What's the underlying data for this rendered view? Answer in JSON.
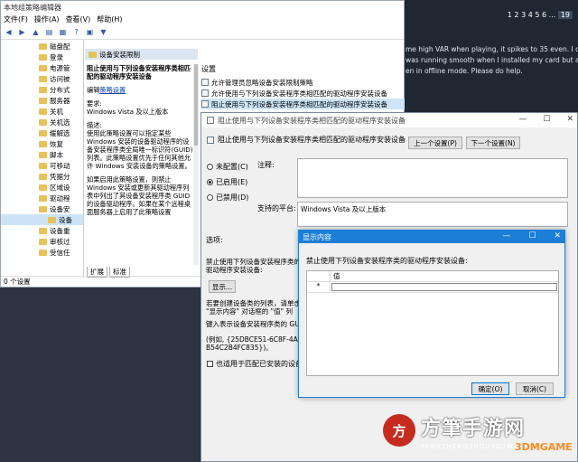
{
  "forum": {
    "pages": [
      "1",
      "2",
      "3",
      "4",
      "5",
      "6",
      "...",
      "19"
    ],
    "lines": [
      "me high VAR when playing, it spikes to 35 even. I ca",
      "was running smooth when I installed my card but aft",
      "en in offline mode. Please do help."
    ]
  },
  "gpedit": {
    "title": "本地组策略编辑器",
    "menu": [
      "文件(F)",
      "操作(A)",
      "查看(V)",
      "帮助(H)"
    ],
    "tree": [
      "磁盘配",
      "登录",
      "电源管",
      "访问被",
      "分布式",
      "服务器",
      "关机",
      "关机选",
      "缓解选",
      "恢复",
      "脚本",
      "可移动",
      "凭据分",
      "区域设",
      "驱动程",
      "设备安",
      "设备",
      "设备重",
      "审核过",
      "受信任"
    ],
    "selected_folder": "设备安装限制",
    "desc_title": "阻止使用与下列设备安装程序类相匹配的驱动程序安装设备",
    "edit_prefix": "编辑",
    "edit_link": "策略设置",
    "req_label": "要求:",
    "req_value": "Windows Vista 及以上版本",
    "desc_label": "描述:",
    "desc_text": "使用此策略设置可以指定某些 Windows 安装的设备驱动程序的设备安装程序类全局唯一标识符(GUID)列表。此策略设置优先于任何其他允许 Windows 安装设备的策略设置。",
    "desc_text2": "如果启用此策略设置，则禁止 Windows 安装或更新其驱动程序列表中列出了其设备安装程序类 GUID 的设备驱动程序。如果在某个远程桌面服务器上启用了此策略设置",
    "tabs": [
      "扩展",
      "标准"
    ],
    "list_head": "设置",
    "list": [
      "允许管理员忽略设备安装限制策略",
      "允许使用与下列设备安装程序类相匹配的驱动程序安装设备",
      "阻止使用与下列设备安装程序类相匹配的驱动程序安装设备"
    ],
    "status": "0 个设置"
  },
  "policy": {
    "title": "阻止使用与下列设备安装程序类相匹配的驱动程序安装设备",
    "header": "阻止使用与下列设备安装程序类相匹配的驱动程序安装设备",
    "prev_btn": "上一个设置(P)",
    "next_btn": "下一个设置(N)",
    "radio_unconfigured": "未配置(C)",
    "radio_enabled": "已启用(E)",
    "radio_disabled": "已禁用(D)",
    "comment_label": "注释:",
    "platform_label": "支持的平台:",
    "platform_value": "Windows Vista 及以上版本",
    "options_label": "选项:",
    "opt_text": "禁止使用下列设备安装程序类的驱动程序安装设备:",
    "show_btn": "显示...",
    "opt_help1": "若要创建设备类的列表，请单击",
    "opt_help2": "\"显示内容\" 对话框的 \"值\" 列",
    "opt_help3": "键入表示设备安装程序类的 GU",
    "opt_help4": "(例如, {25DBCE51-6C8F-4A7",
    "opt_help5": "B54C2B4FC835})。",
    "checkbox": "也适用于匹配已安装的设备。"
  },
  "show": {
    "title": "显示内容",
    "label": "禁止使用下列设备安装程序类的驱动程序安装设备:",
    "col": "值",
    "row_marker": "*",
    "ok": "确定(O)",
    "cancel": "取消(C)"
  },
  "watermark": {
    "logo": "方",
    "name": "方筆手游网",
    "url": "FANGZHENGSHOUYOUWANG",
    "brand": "3DMGAME"
  }
}
